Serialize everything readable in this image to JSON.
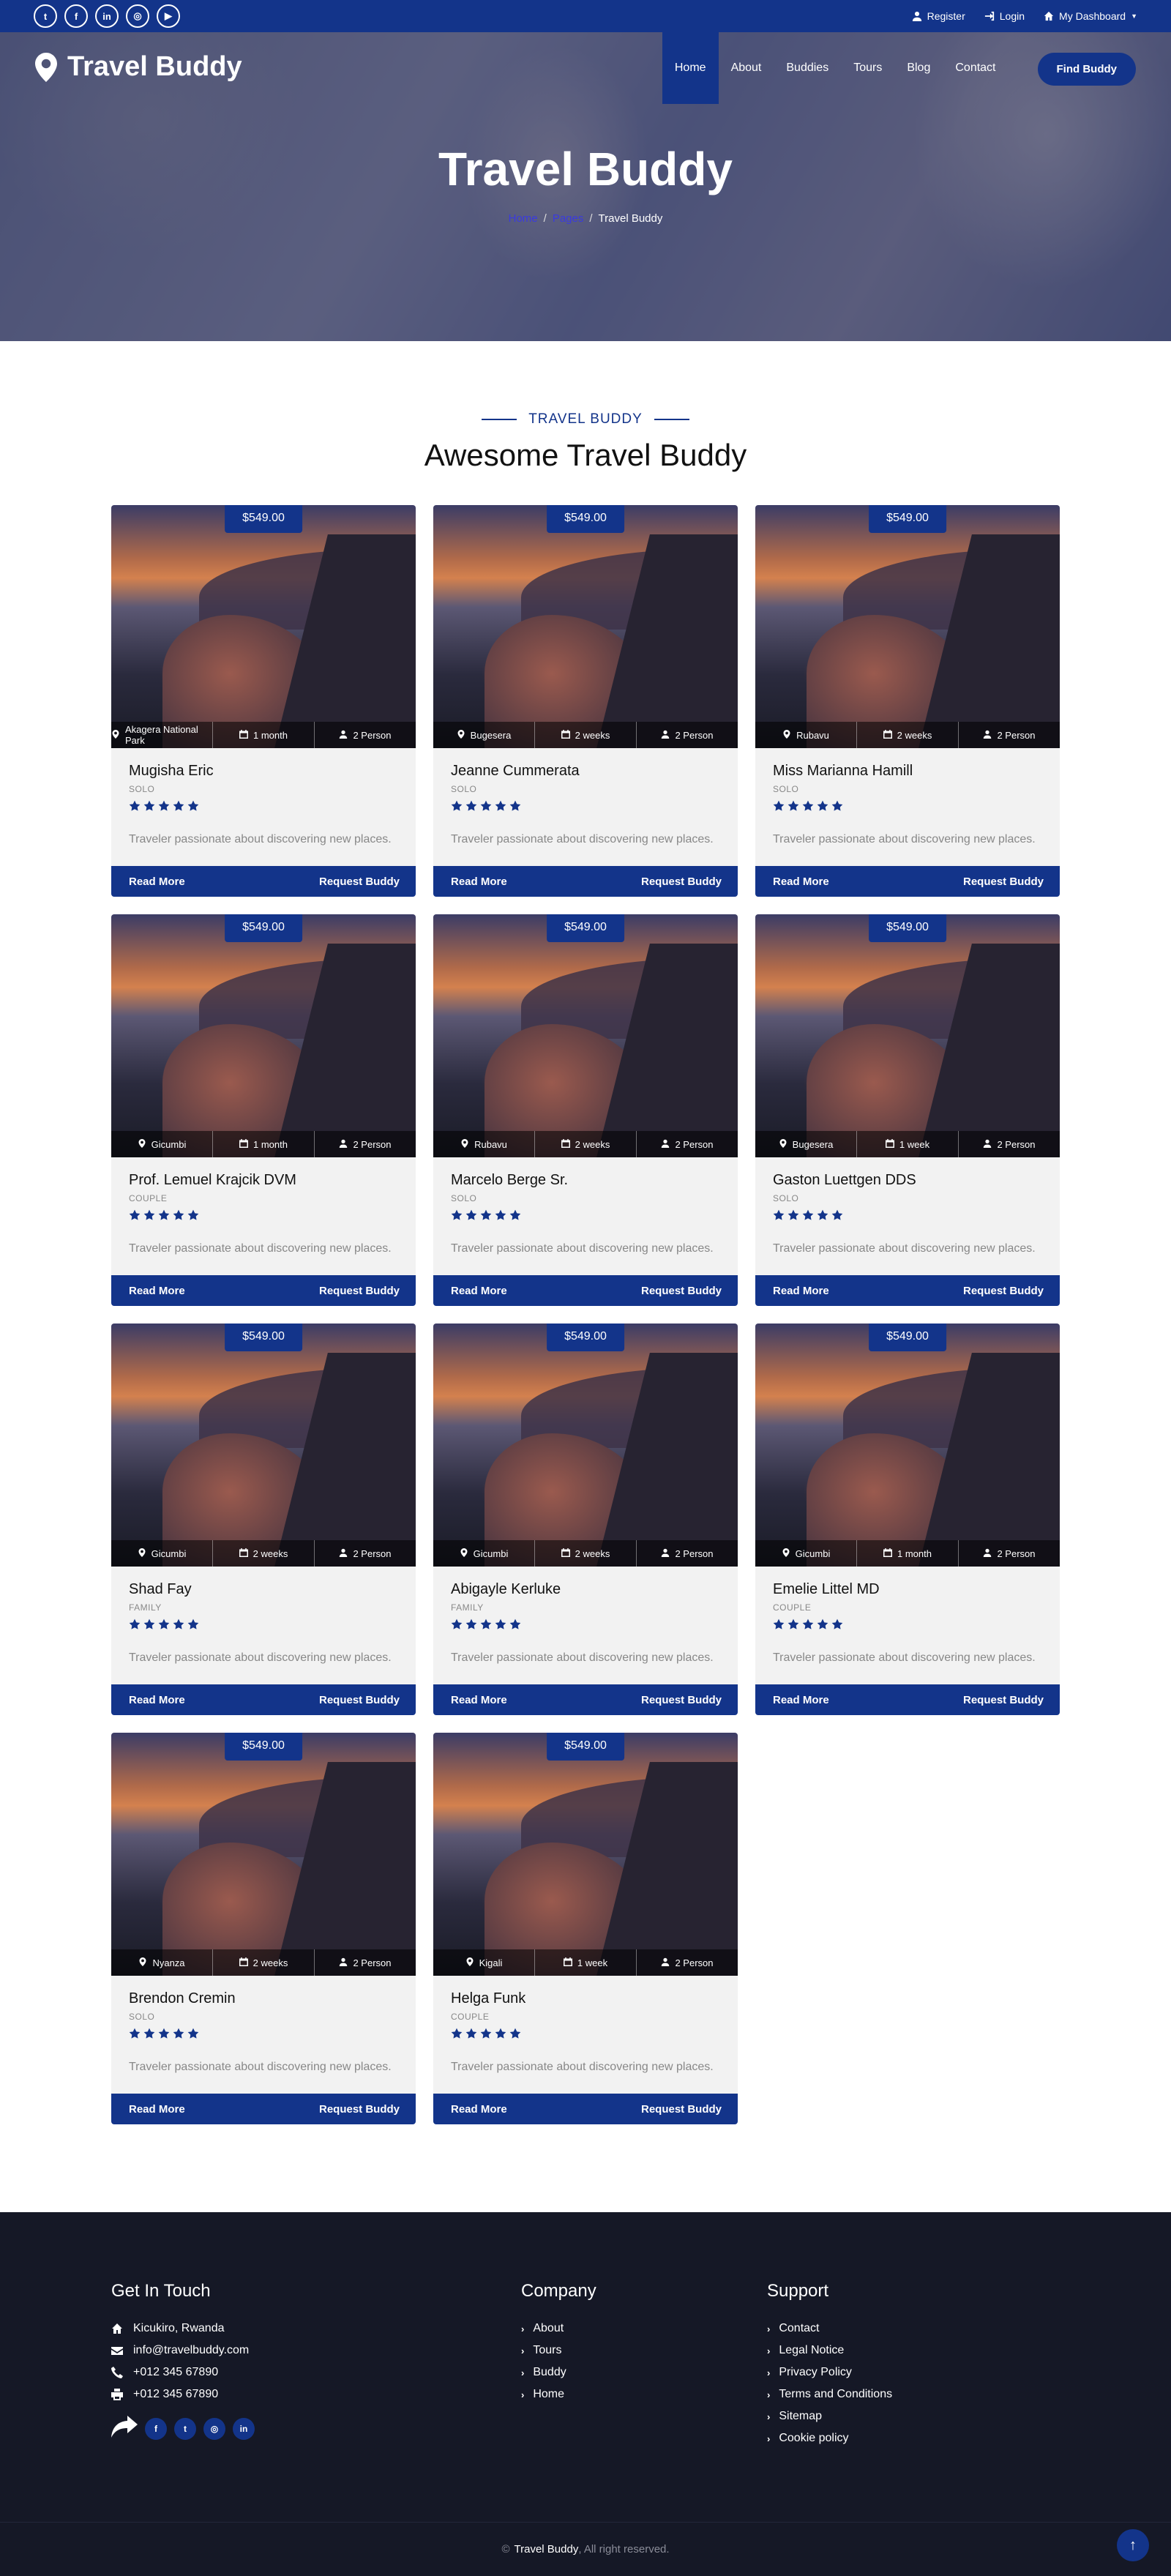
{
  "topbar": {
    "socials": [
      {
        "icon": "twitter-icon",
        "glyph": "t"
      },
      {
        "icon": "facebook-icon",
        "glyph": "f"
      },
      {
        "icon": "linkedin-icon",
        "glyph": "in"
      },
      {
        "icon": "instagram-icon",
        "glyph": "◎"
      },
      {
        "icon": "youtube-icon",
        "glyph": "▶"
      }
    ],
    "register": "Register",
    "login": "Login",
    "dashboard": "My Dashboard"
  },
  "brand": "Travel Buddy",
  "nav": {
    "items": [
      "Home",
      "About",
      "Buddies",
      "Tours",
      "Blog",
      "Contact"
    ],
    "active": "Home",
    "cta": "Find Buddy"
  },
  "hero": {
    "title": "Travel Buddy",
    "breadcrumb": [
      "Home",
      "Pages",
      "Travel Buddy"
    ]
  },
  "section": {
    "eyebrow": "TRAVEL BUDDY",
    "title": "Awesome Travel Buddy"
  },
  "card_actions": {
    "read_more": "Read More",
    "request": "Request Buddy"
  },
  "cards": [
    {
      "price": "$549.00",
      "location": "Akagera National Park",
      "duration": "1 month",
      "persons": "2 Person",
      "name": "Mugisha Eric",
      "type": "SOLO",
      "rating": 5,
      "desc": "Traveler passionate about discovering new places."
    },
    {
      "price": "$549.00",
      "location": "Bugesera",
      "duration": "2 weeks",
      "persons": "2 Person",
      "name": "Jeanne Cummerata",
      "type": "SOLO",
      "rating": 5,
      "desc": "Traveler passionate about discovering new places."
    },
    {
      "price": "$549.00",
      "location": "Rubavu",
      "duration": "2 weeks",
      "persons": "2 Person",
      "name": "Miss Marianna Hamill",
      "type": "SOLO",
      "rating": 5,
      "desc": "Traveler passionate about discovering new places."
    },
    {
      "price": "$549.00",
      "location": "Gicumbi",
      "duration": "1 month",
      "persons": "2 Person",
      "name": "Prof. Lemuel Krajcik DVM",
      "type": "COUPLE",
      "rating": 5,
      "desc": "Traveler passionate about discovering new places."
    },
    {
      "price": "$549.00",
      "location": "Rubavu",
      "duration": "2 weeks",
      "persons": "2 Person",
      "name": "Marcelo Berge Sr.",
      "type": "SOLO",
      "rating": 5,
      "desc": "Traveler passionate about discovering new places."
    },
    {
      "price": "$549.00",
      "location": "Bugesera",
      "duration": "1 week",
      "persons": "2 Person",
      "name": "Gaston Luettgen DDS",
      "type": "SOLO",
      "rating": 5,
      "desc": "Traveler passionate about discovering new places."
    },
    {
      "price": "$549.00",
      "location": "Gicumbi",
      "duration": "2 weeks",
      "persons": "2 Person",
      "name": "Shad Fay",
      "type": "FAMILY",
      "rating": 5,
      "desc": "Traveler passionate about discovering new places."
    },
    {
      "price": "$549.00",
      "location": "Gicumbi",
      "duration": "2 weeks",
      "persons": "2 Person",
      "name": "Abigayle Kerluke",
      "type": "FAMILY",
      "rating": 5,
      "desc": "Traveler passionate about discovering new places."
    },
    {
      "price": "$549.00",
      "location": "Gicumbi",
      "duration": "1 month",
      "persons": "2 Person",
      "name": "Emelie Littel MD",
      "type": "COUPLE",
      "rating": 5,
      "desc": "Traveler passionate about discovering new places."
    },
    {
      "price": "$549.00",
      "location": "Nyanza",
      "duration": "2 weeks",
      "persons": "2 Person",
      "name": "Brendon Cremin",
      "type": "SOLO",
      "rating": 5,
      "desc": "Traveler passionate about discovering new places."
    },
    {
      "price": "$549.00",
      "location": "Kigali",
      "duration": "1 week",
      "persons": "2 Person",
      "name": "Helga Funk",
      "type": "COUPLE",
      "rating": 5,
      "desc": "Traveler passionate about discovering new places."
    }
  ],
  "footer": {
    "contact_title": "Get In Touch",
    "address": "Kicukiro, Rwanda",
    "email": "info@travelbuddy.com",
    "phone": "+012 345 67890",
    "fax": "+012 345 67890",
    "socials": [
      {
        "icon": "facebook-icon",
        "glyph": "f"
      },
      {
        "icon": "twitter-icon",
        "glyph": "t"
      },
      {
        "icon": "instagram-icon",
        "glyph": "◎"
      },
      {
        "icon": "linkedin-icon",
        "glyph": "in"
      }
    ],
    "company_title": "Company",
    "company_links": [
      "About",
      "Tours",
      "Buddy",
      "Home"
    ],
    "support_title": "Support",
    "support_links": [
      "Contact",
      "Legal Notice",
      "Privacy Policy",
      "Terms and Conditions",
      "Sitemap",
      "Cookie policy"
    ],
    "copyright_brand": "Travel Buddy",
    "copyright_text": ", All right reserved.",
    "copyright_symbol": "©"
  },
  "colors": {
    "primary": "#13348a",
    "footer_bg": "#151826",
    "card_bg": "#f2f2f2"
  }
}
